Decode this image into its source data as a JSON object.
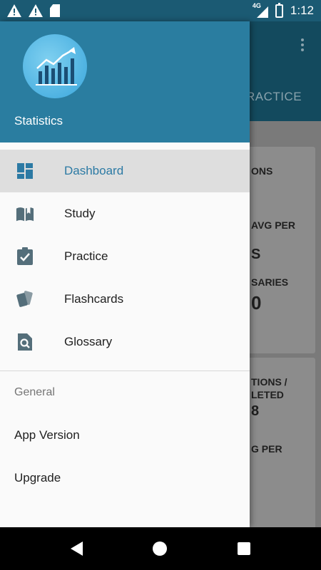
{
  "status_bar": {
    "network": "4G",
    "time": "1:12"
  },
  "drawer": {
    "header_title": "Statistics",
    "nav_items": [
      {
        "label": "Dashboard",
        "icon": "dashboard-icon",
        "active": true
      },
      {
        "label": "Study",
        "icon": "book-icon",
        "active": false
      },
      {
        "label": "Practice",
        "icon": "clipboard-check-icon",
        "active": false
      },
      {
        "label": "Flashcards",
        "icon": "cards-icon",
        "active": false
      },
      {
        "label": "Glossary",
        "icon": "search-doc-icon",
        "active": false
      }
    ],
    "section_title": "General",
    "general_items": [
      "App Version",
      "Upgrade"
    ]
  },
  "background": {
    "tab_fragment": "RACTICE",
    "card1_lines": [
      "ONS",
      "AVG PER",
      "S",
      "SARIES",
      "0"
    ],
    "card2_lines": [
      "TIONS /",
      "LETED",
      "8",
      "G PER"
    ]
  },
  "colors": {
    "header": "#2a7da0",
    "active_text": "#2c7aa4",
    "icon": "#546e7a"
  }
}
